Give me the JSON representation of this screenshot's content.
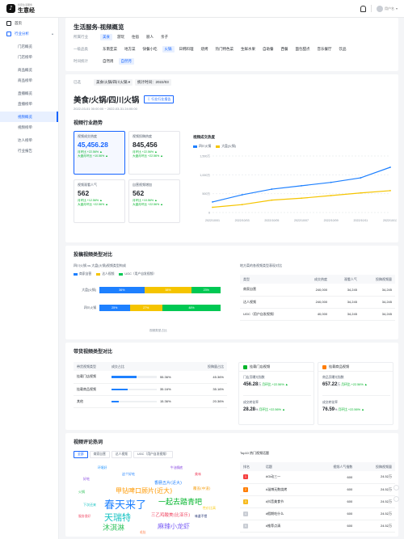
{
  "brand": {
    "logo_glyph": "♪",
    "sub": "抖音生活服务",
    "name": "生意经"
  },
  "user": {
    "name": "用户名"
  },
  "sidebar": {
    "items": [
      {
        "label": "首页",
        "type": "group"
      },
      {
        "label": "行业分析",
        "type": "active-group"
      },
      {
        "label": "门店概览",
        "type": "sub"
      },
      {
        "label": "门店榜单",
        "type": "sub"
      },
      {
        "label": "商品概览",
        "type": "sub"
      },
      {
        "label": "商品榜单",
        "type": "sub"
      },
      {
        "label": "直播概览",
        "type": "sub"
      },
      {
        "label": "直播榜单",
        "type": "sub"
      },
      {
        "label": "视频概览",
        "type": "sub-active"
      },
      {
        "label": "视频榜单",
        "type": "sub"
      },
      {
        "label": "达人榜单",
        "type": "sub"
      },
      {
        "label": "行业报告",
        "type": "sub"
      }
    ]
  },
  "page": {
    "title": "生活服务-视频概览",
    "filters": [
      {
        "label": "所属行业",
        "chips": [
          "美食",
          "游玩",
          "住宿",
          "丽人",
          "亲子"
        ],
        "on": [
          0
        ]
      },
      {
        "label": "一级品类",
        "chips": [
          "东南亚菜",
          "地方菜",
          "快餐小吃",
          "火锅",
          "日韩料理",
          "烧烤",
          "热门特色菜",
          "生鲜水果",
          "自助餐",
          "西餐",
          "面包甜点",
          "音乐餐厅",
          "饮品"
        ],
        "on": [
          3
        ]
      },
      {
        "label": "时间统计",
        "chips": [
          "自然周",
          "自然月"
        ],
        "on": [
          1
        ]
      }
    ],
    "selected": {
      "label": "已选",
      "tag": "美食/火锅/四川火锅",
      "date": "统计时间：2022/03"
    },
    "heading": "美食/火锅/四川火锅",
    "export_btn": "⇩ 行业行业报告",
    "range": "2022-03-01 00:00:00 ~ 2022-03-31 24:00:00"
  },
  "trend": {
    "title": "视频行业趋势",
    "cards": [
      {
        "label": "视频成交热度",
        "value": "45,456.28",
        "cmp1": "月环比 +22.56% ▲",
        "cmp2": "大盘月环比 +10.56% ▲"
      },
      {
        "label": "视频投稿热度",
        "value": "845,456",
        "cmp1": "月环比 +22.56% ▲",
        "cmp2": "大盘月环比 +22.56% ▲"
      },
      {
        "label": "视频观看人气",
        "value": "562",
        "cmp1": "月环比 +12.56% ▲",
        "cmp2": "大盘月环比 +22.56% ▲"
      },
      {
        "label": "自营视频增加",
        "value": "562",
        "cmp1": "月环比 +10.56% ▲",
        "cmp2": "大盘月环比 +22.56% ▲"
      }
    ]
  },
  "chart_data": {
    "type": "line",
    "title": "视频成交热度",
    "x": [
      "2022/10/01",
      "2022/10/03",
      "2022/10/05",
      "2022/10/07",
      "2022/10/09",
      "2022/10/11",
      "2022/10/13"
    ],
    "ylim": [
      0,
      1500
    ],
    "yticks": [
      "1,500万",
      "1,000万",
      "500万",
      "0"
    ],
    "series": [
      {
        "name": "四川火锅",
        "color": "#1e80ff",
        "values": [
          280,
          470,
          620,
          710,
          800,
          920,
          1200
        ]
      },
      {
        "name": "大盘(火锅)",
        "color": "#f5c400",
        "values": [
          140,
          210,
          330,
          380,
          450,
          520,
          580
        ]
      }
    ],
    "grid": true,
    "legend": "top-left"
  },
  "videoType": {
    "title": "投稿视频类型对比",
    "sub_left": "四川火锅 vs 大盘(火锅)视频类型构成",
    "legend": [
      "商家自营",
      "达人视频",
      "UGC（用户自发视频）"
    ],
    "legend_colors": [
      "#1e80ff",
      "#f5c400",
      "#00c853"
    ],
    "bars": [
      {
        "label": "大盘(火锅)",
        "vals": [
          36,
          38,
          23
        ],
        "texts": [
          "36%",
          "38%",
          "23%"
        ]
      },
      {
        "label": "四川火锅",
        "vals": [
          25,
          27,
          48
        ],
        "texts": [
          "25%",
          "27%",
          "48%"
        ]
      }
    ],
    "axis_note": "视频类型占比",
    "sub_right": "地方菜的各视频类型表现对比",
    "table": {
      "headers": [
        "类型",
        "成交热度",
        "观看人气",
        "投稿视频量"
      ],
      "rows": [
        [
          "商家自营",
          "240,000",
          "34,245",
          "34,245"
        ],
        [
          "达人视频",
          "240,000",
          "34,245",
          "34,245"
        ],
        [
          "UGC（用户自发视频）",
          "40,000",
          "34,245",
          "34,245"
        ]
      ]
    }
  },
  "sales": {
    "title": "带货视频类型对比",
    "headers": [
      "带货视频类型",
      "成交占比",
      "投稿量占比"
    ],
    "rows": [
      {
        "name": "挂载门店视频",
        "pct": 55.36,
        "pct_text": "55.36%",
        "share": "45.36%"
      },
      {
        "name": "挂载商品视频",
        "pct": 35.16,
        "pct_text": "35.16%",
        "share": "35.16%"
      },
      {
        "name": "其他",
        "pct": 15.36,
        "pct_text": "15.36%",
        "share": "20.36%"
      }
    ],
    "shop": {
      "title": "挂载门店视频",
      "m1": "门店页曝光指数",
      "v1": "456.28",
      "u1": "万",
      "c1": "月环比 +22.56% ▲",
      "m2": "成交转化率",
      "v2": "28.28",
      "u2": "%",
      "c2": "月环比 +22.56% ▲"
    },
    "goods": {
      "title": "挂载商品视频",
      "m1": "商品页曝光指数",
      "v1": "657.22",
      "u1": "万",
      "c1": "月环比 +22.56% ▲",
      "m2": "成交转化率",
      "v2": "76.59",
      "u2": "%",
      "c2": "月环比 +22.56% ▲"
    }
  },
  "comments": {
    "title": "视频评论热词",
    "tabs": [
      "全部",
      "商家自营",
      "达人视频",
      "UGC（用户自发视频）"
    ],
    "words": [
      {
        "t": "春天来了",
        "s": 13,
        "c": "#1e80ff"
      },
      {
        "t": "一起去踏青吧",
        "s": 9,
        "c": "#00b42a"
      },
      {
        "t": "甲钻啤口顾片(近大)",
        "s": 8,
        "c": "#ff9900"
      },
      {
        "t": "天瑞特",
        "s": 11,
        "c": "#13c2c2"
      },
      {
        "t": "沐淇淋",
        "s": 9,
        "c": "#2fc25b"
      },
      {
        "t": "麻辣小龙虾",
        "s": 8,
        "c": "#7b5ff5"
      },
      {
        "t": "三乙鸡酸美(比亚乐)",
        "s": 5.5,
        "c": "#f04864"
      },
      {
        "t": "香肠五片(近大)",
        "s": 5,
        "c": "#1e80ff"
      },
      {
        "t": "覆盖(中道)",
        "s": 4.5,
        "c": "#f5a623"
      },
      {
        "t": "好吃",
        "s": 4,
        "c": "#8543e0"
      },
      {
        "t": "这个好吃",
        "s": 4,
        "c": "#1e80ff"
      },
      {
        "t": "美味",
        "s": 4,
        "c": "#f04864"
      },
      {
        "t": "下次还来",
        "s": 4,
        "c": "#13c2c2"
      },
      {
        "t": "性价比高",
        "s": 4,
        "c": "#facc14"
      },
      {
        "t": "火锅",
        "s": 4,
        "c": "#2fc25b"
      },
      {
        "t": "味道不错",
        "s": 3.8,
        "c": "#223273"
      },
      {
        "t": "服务很好",
        "s": 3.8,
        "c": "#f04864"
      },
      {
        "t": "环境好",
        "s": 3.8,
        "c": "#1890ff"
      },
      {
        "t": "牛油锅底",
        "s": 3.8,
        "c": "#8543e0"
      },
      {
        "t": "毛肚",
        "s": 3.8,
        "c": "#ff7a45"
      }
    ],
    "top_title": "Top10 热门视频话题",
    "top_headers": [
      "排名",
      "话题",
      "视频人气指数",
      "投稿视频量"
    ],
    "top_rows": [
      {
        "rank": "1",
        "topic": "#Gi动三一",
        "hot": "600",
        "vol": "24.52万",
        "c": "#f53f3f"
      },
      {
        "rank": "2",
        "topic": "#淄博无数烧烤",
        "hot": "600",
        "vol": "24.52万",
        "c": "#ff7d00"
      },
      {
        "rank": "3",
        "topic": "#抖音美食节",
        "hot": "600",
        "vol": "24.52万",
        "c": "#f7ba1e"
      },
      {
        "rank": "4",
        "topic": "#假期吃什么",
        "hot": "600",
        "vol": "24.52万",
        "c": "#c9cdd4"
      },
      {
        "rank": "5",
        "topic": "#推荐点清",
        "hot": "600",
        "vol": "24.52万",
        "c": "#c9cdd4"
      }
    ]
  }
}
